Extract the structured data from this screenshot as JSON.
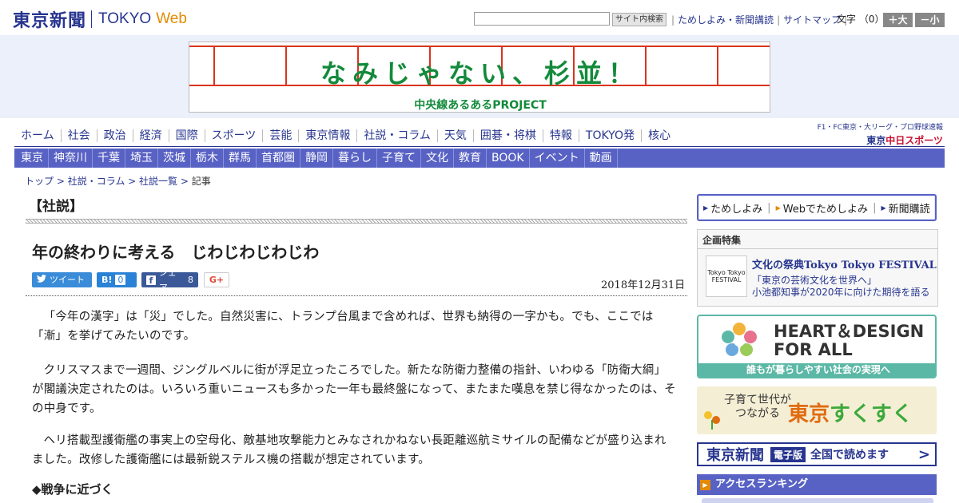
{
  "header": {
    "logo_ja": "東京新聞",
    "logo_en_1": "TOKYO",
    "logo_en_2": "Web",
    "search_button": "サイト内検索",
    "links": [
      "ためしよみ・新聞講読",
      "サイトマップ"
    ],
    "font_size_label": "文字",
    "font_size_count": "（0）",
    "font_plus": "＋大",
    "font_minus": "－小"
  },
  "banner": {
    "title": "なみじゃない、杉並！",
    "subtitle": "中央線あるあるPROJECT"
  },
  "main_nav": [
    "ホーム",
    "社会",
    "政治",
    "経済",
    "国際",
    "スポーツ",
    "芸能",
    "東京情報",
    "社説・コラム",
    "天気",
    "囲碁・将棋",
    "特報",
    "TOKYO発",
    "核心"
  ],
  "sports": {
    "small_text": "F1・FC東京・大リーグ・プロ野球速報",
    "logo_prefix": "東京",
    "logo_main": "中日スポーツ"
  },
  "region_nav": [
    "東京",
    "神奈川",
    "千葉",
    "埼玉",
    "茨城",
    "栃木",
    "群馬",
    "首都圏",
    "静岡",
    "暮らし",
    "子育て",
    "文化",
    "教育",
    "BOOK",
    "イベント",
    "動画"
  ],
  "breadcrumb": [
    "トップ",
    "社説・コラム",
    "社説一覧",
    "記事"
  ],
  "article": {
    "section": "【社説】",
    "title": "年の終わりに考える　じわじわじわじわ",
    "date": "2018年12月31日",
    "paragraphs": [
      "「今年の漢字」は「災」でした。自然災害に、トランプ台風まで含めれば、世界も納得の一字かも。でも、ここでは「漸」を挙げてみたいのです。",
      "クリスマスまで一週間、ジングルベルに街が浮足立ったころでした。新たな防衛力整備の指針、いわゆる「防衛大綱」が閣議決定されたのは。いろいろ重いニュースも多かった一年も最終盤になって、またまた嘆息を禁じ得なかったのは、その中身です。",
      "ヘリ搭載型護衛艦の事実上の空母化、敵基地攻撃能力とみなされかねない長距離巡航ミサイルの配備などが盛り込まれました。改修した護衛艦には最新鋭ステルス機の搭載が想定されています。"
    ],
    "subheading": "◆戦争に近づく"
  },
  "share": {
    "tweet": "ツイート",
    "hatena_icon": "B!",
    "hatena_count": "0",
    "facebook_icon": "f",
    "facebook_label": "シェア",
    "facebook_count": "8",
    "gplus": "G+"
  },
  "sidebar": {
    "subscribe_links": [
      "ためしよみ",
      "Webでためしよみ",
      "新聞購読"
    ],
    "feature_label": "企画特集",
    "feature_thumb": "Tokyo Tokyo FESTIVAL",
    "feature_title": "文化の祭典Tokyo Tokyo FESTIVAL",
    "feature_desc_1": "「東京の芸術文化を世界へ」",
    "feature_desc_2": "小池都知事が2020年に向けた期待を語る",
    "hd_title_1": "HEART＆DESIGN",
    "hd_title_2": "FOR ALL",
    "hd_footer": "誰もが暮らしやすい社会の実現へ",
    "kosodate_sub_1": "子育て世代が",
    "kosodate_sub_2": "つながる",
    "kosodate_title_1": "東京",
    "kosodate_title_2": "すくすく",
    "denshi_logo": "東京新聞",
    "denshi_tag": "電子版",
    "denshi_text": "全国で読めます",
    "ranking_label": "アクセスランキング"
  },
  "colors": {
    "brand_navy": "#27358f",
    "nav_purple": "#5862c4",
    "accent_orange": "#e38a00",
    "banner_green": "#138a3b",
    "banner_red": "#d9341e"
  }
}
